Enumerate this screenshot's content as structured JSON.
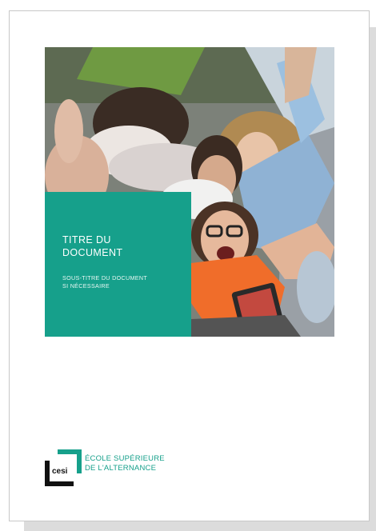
{
  "document": {
    "title_line1": "TITRE DU",
    "title_line2": "DOCUMENT",
    "subtitle_line1": "SOUS-TITRE DU DOCUMENT",
    "subtitle_line2": "SI NÉCESSAIRE"
  },
  "logo": {
    "wordmark": "cesi",
    "school_line1": "ÉCOLE SUPÉRIEURE",
    "school_line2": "DE L'ALTERNANCE"
  },
  "colors": {
    "accent": "#16a08b",
    "page_border": "#c8c8c8",
    "shadow": "#dcdcdc"
  },
  "hero_image": {
    "description_icon": "group-selfie-photo-icon"
  }
}
